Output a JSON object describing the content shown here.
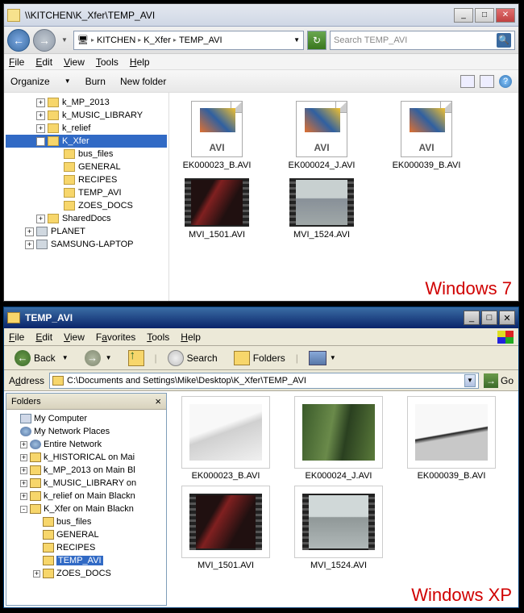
{
  "win7": {
    "title": "\\\\KITCHEN\\K_Xfer\\TEMP_AVI",
    "breadcrumb": {
      "root_icon": "computer",
      "parts": [
        "KITCHEN",
        "K_Xfer",
        "TEMP_AVI"
      ]
    },
    "search_placeholder": "Search TEMP_AVI",
    "menu": [
      "File",
      "Edit",
      "View",
      "Tools",
      "Help"
    ],
    "toolbar": {
      "organize": "Organize",
      "burn": "Burn",
      "newfolder": "New folder"
    },
    "tree": [
      {
        "ind": 1,
        "exp": "+",
        "icon": "f",
        "label": "k_MP_2013"
      },
      {
        "ind": 1,
        "exp": "+",
        "icon": "f",
        "label": "k_MUSIC_LIBRARY"
      },
      {
        "ind": 1,
        "exp": "+",
        "icon": "f",
        "label": "k_relief"
      },
      {
        "ind": 1,
        "exp": "-",
        "icon": "f",
        "label": "K_Xfer",
        "sel": true
      },
      {
        "ind": 2,
        "exp": "",
        "icon": "f",
        "label": "bus_files"
      },
      {
        "ind": 2,
        "exp": "",
        "icon": "f",
        "label": "GENERAL"
      },
      {
        "ind": 2,
        "exp": "",
        "icon": "f",
        "label": "RECIPES"
      },
      {
        "ind": 2,
        "exp": "",
        "icon": "f",
        "label": "TEMP_AVI"
      },
      {
        "ind": 2,
        "exp": "",
        "icon": "f",
        "label": "ZOES_DOCS"
      },
      {
        "ind": 1,
        "exp": "+",
        "icon": "f",
        "label": "SharedDocs"
      },
      {
        "ind": 0,
        "exp": "+",
        "icon": "p",
        "label": "PLANET"
      },
      {
        "ind": 0,
        "exp": "+",
        "icon": "p",
        "label": "SAMSUNG-LAPTOP"
      }
    ],
    "files": [
      {
        "name": "EK000023_B.AVI",
        "type": "avi-placeholder"
      },
      {
        "name": "EK000024_J.AVI",
        "type": "avi-placeholder"
      },
      {
        "name": "EK000039_B.AVI",
        "type": "avi-placeholder"
      },
      {
        "name": "MVI_1501.AVI",
        "type": "film",
        "bg": "linear-gradient(120deg,#201010 30%,#802020 40%,#201010 70%)"
      },
      {
        "name": "MVI_1524.AVI",
        "type": "film",
        "bg": "linear-gradient(#c8d0d0 40%,#889098 42%,#a0a8a8)"
      }
    ],
    "caption": "Windows 7"
  },
  "winxp": {
    "title": "TEMP_AVI",
    "menu": [
      "File",
      "Edit",
      "View",
      "Favorites",
      "Tools",
      "Help"
    ],
    "btn_back": "Back",
    "btn_search": "Search",
    "btn_folders": "Folders",
    "addr_label": "Address",
    "addr_path": "C:\\Documents and Settings\\Mike\\Desktop\\K_Xfer\\TEMP_AVI",
    "go": "Go",
    "panel_title": "Folders",
    "tree": [
      {
        "ind": 0,
        "exp": "",
        "icon": "p",
        "label": "My Computer"
      },
      {
        "ind": 0,
        "exp": "",
        "icon": "n",
        "label": "My Network Places"
      },
      {
        "ind": 1,
        "exp": "+",
        "icon": "n",
        "label": "Entire Network"
      },
      {
        "ind": 1,
        "exp": "+",
        "icon": "f",
        "label": "k_HISTORICAL on Mai"
      },
      {
        "ind": 1,
        "exp": "+",
        "icon": "f",
        "label": "k_MP_2013 on Main Bl"
      },
      {
        "ind": 1,
        "exp": "+",
        "icon": "f",
        "label": "k_MUSIC_LIBRARY on"
      },
      {
        "ind": 1,
        "exp": "+",
        "icon": "f",
        "label": "k_relief on Main Blackn"
      },
      {
        "ind": 1,
        "exp": "-",
        "icon": "f",
        "label": "K_Xfer on Main Blackn"
      },
      {
        "ind": 2,
        "exp": "",
        "icon": "f",
        "label": "bus_files"
      },
      {
        "ind": 2,
        "exp": "",
        "icon": "f",
        "label": "GENERAL"
      },
      {
        "ind": 2,
        "exp": "",
        "icon": "f",
        "label": "RECIPES"
      },
      {
        "ind": 2,
        "exp": "",
        "icon": "f",
        "label": "TEMP_AVI",
        "sel": true
      },
      {
        "ind": 2,
        "exp": "+",
        "icon": "f",
        "label": "ZOES_DOCS"
      }
    ],
    "files": [
      {
        "name": "EK000023_B.AVI",
        "bg": "linear-gradient(160deg,#f8f8f8 40%,#d0d0d0 50%,#f0f0f0)"
      },
      {
        "name": "EK000024_J.AVI",
        "bg": "linear-gradient(100deg,#3a5a2a,#6a8a4a 40%,#2a4020 60%,#5a7a3a)"
      },
      {
        "name": "EK000039_B.AVI",
        "bg": "linear-gradient(170deg,#f8f8f8 50%,#202020 52%,#c8c8c8 58%)"
      },
      {
        "name": "MVI_1501.AVI",
        "bg": "linear-gradient(120deg,#201010 30%,#802020 40%,#201010 70%)",
        "film": true
      },
      {
        "name": "MVI_1524.AVI",
        "bg": "linear-gradient(#d0d8d8 40%,#909898 42%,#b0b8b8)",
        "film": true
      }
    ],
    "caption": "Windows XP"
  }
}
